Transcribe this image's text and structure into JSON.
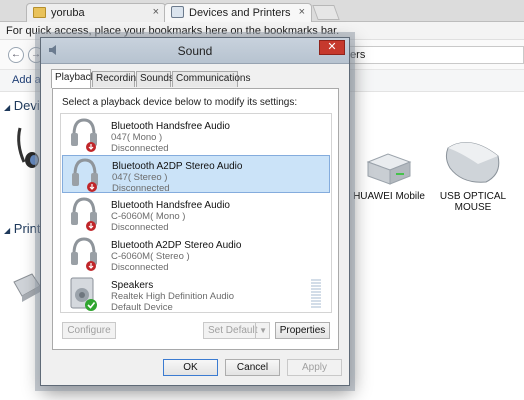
{
  "browser": {
    "tabs": [
      {
        "label": "yoruba",
        "close": "×"
      },
      {
        "label": "Devices and Printers",
        "close": "×"
      }
    ],
    "bookmark_bar_text": "For quick access, place your bookmarks here on the bookmarks bar.",
    "address_tail": "ters",
    "command_bar": "Add a",
    "sections": [
      {
        "label": "Devi"
      },
      {
        "label": "Print"
      }
    ],
    "devices": [
      {
        "label": "HUAWEI Mobile"
      },
      {
        "label": "USB OPTICAL MOUSE"
      }
    ]
  },
  "dialog": {
    "title": "Sound",
    "close": "✕",
    "tabs": [
      "Playback",
      "Recording",
      "Sounds",
      "Communications"
    ],
    "instruction": "Select a playback device below to modify its settings:",
    "devices": [
      {
        "name": "Bluetooth Handsfree Audio",
        "detail": "047( Mono )",
        "status": "Disconnected"
      },
      {
        "name": "Bluetooth A2DP Stereo Audio",
        "detail": "047( Stereo )",
        "status": "Disconnected"
      },
      {
        "name": "Bluetooth Handsfree Audio",
        "detail": "C-6060M( Mono )",
        "status": "Disconnected"
      },
      {
        "name": "Bluetooth A2DP Stereo Audio",
        "detail": "C-6060M( Stereo )",
        "status": "Disconnected"
      },
      {
        "name": "Speakers",
        "detail": "Realtek High Definition Audio",
        "status": "Default Device"
      }
    ],
    "selected_index": 1,
    "buttons": {
      "configure": "Configure",
      "set_default": "Set Default",
      "properties": "Properties",
      "ok": "OK",
      "cancel": "Cancel",
      "apply": "Apply"
    }
  },
  "colors": {
    "accent": "#3b7bd1",
    "selection": "#cbe3f8",
    "close_red": "#c6392d",
    "disconnect_red": "#c0262a",
    "default_green": "#2fa52f"
  }
}
